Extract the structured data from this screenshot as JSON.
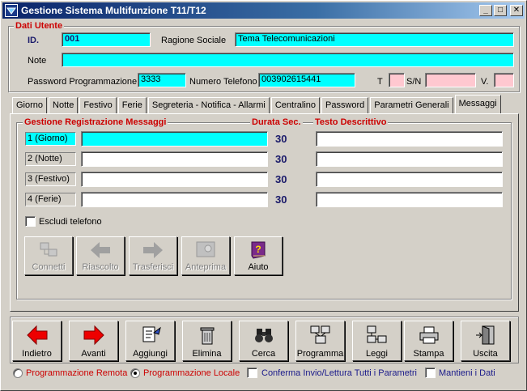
{
  "window": {
    "title": "Gestione Sistema Multifunzione T11/T12"
  },
  "user_section": {
    "legend": "Dati Utente",
    "id_label": "ID.",
    "id_value": "001",
    "ragione_label": "Ragione Sociale",
    "ragione_value": "Tema Telecomunicazioni",
    "note_label": "Note",
    "note_value": "",
    "password_label": "Password Programmazione",
    "password_value": "3333",
    "phone_label": "Numero Telefono",
    "phone_value": "003902615441",
    "t_label": "T",
    "t_value": "",
    "sn_label": "S/N",
    "sn_value": "",
    "v_label": "V.",
    "v_value": ""
  },
  "tabs": [
    {
      "label": "Giorno"
    },
    {
      "label": "Notte"
    },
    {
      "label": "Festivo"
    },
    {
      "label": "Ferie"
    },
    {
      "label": "Segreteria - Notifica - Allarmi"
    },
    {
      "label": "Centralino"
    },
    {
      "label": "Password"
    },
    {
      "label": "Parametri Generali"
    },
    {
      "label": "Messaggi"
    }
  ],
  "messages": {
    "header_left": "Gestione Registrazione Messaggi",
    "header_duration": "Durata Sec.",
    "header_desc": "Testo Descrittivo",
    "rows": [
      {
        "label": "1 (Giorno)",
        "value": "",
        "duration": "30",
        "desc": ""
      },
      {
        "label": "2 (Notte)",
        "value": "",
        "duration": "30",
        "desc": ""
      },
      {
        "label": "3 (Festivo)",
        "value": "",
        "duration": "30",
        "desc": ""
      },
      {
        "label": "4 (Ferie)",
        "value": "",
        "duration": "30",
        "desc": ""
      }
    ],
    "exclude_phone_label": "Escludi telefono",
    "actions": [
      {
        "label": "Connetti",
        "icon": "connect-icon",
        "enabled": false
      },
      {
        "label": "Riascolto",
        "icon": "arrow-left-icon",
        "enabled": false
      },
      {
        "label": "Trasferisci",
        "icon": "arrow-right-icon",
        "enabled": false
      },
      {
        "label": "Anteprima",
        "icon": "preview-icon",
        "enabled": false
      },
      {
        "label": "Aiuto",
        "icon": "help-book-icon",
        "enabled": true
      }
    ]
  },
  "toolbar": [
    {
      "label": "Indietro",
      "icon": "red-arrow-left-icon"
    },
    {
      "label": "Avanti",
      "icon": "red-arrow-right-icon"
    },
    {
      "label": "Aggiungi",
      "icon": "add-document-icon"
    },
    {
      "label": "Elimina",
      "icon": "trash-icon"
    },
    {
      "label": "Cerca",
      "icon": "binoculars-icon"
    },
    {
      "label": "Programma",
      "icon": "program-icon"
    },
    {
      "label": "Leggi",
      "icon": "read-icon"
    },
    {
      "label": "Stampa",
      "icon": "printer-icon"
    },
    {
      "label": "Uscita",
      "icon": "exit-door-icon"
    }
  ],
  "options": {
    "remote_label": "Programmazione Remota",
    "local_label": "Programmazione Locale",
    "selected": "local",
    "confirm_label": "Conferma Invio/Lettura Tutti i Parametri",
    "keep_label": "Mantieni i Dati"
  },
  "colors": {
    "field_cyan": "#00ffff",
    "field_pink": "#ffc8d0",
    "legend_red": "#cc0000",
    "title_blue": "#0a246a"
  }
}
